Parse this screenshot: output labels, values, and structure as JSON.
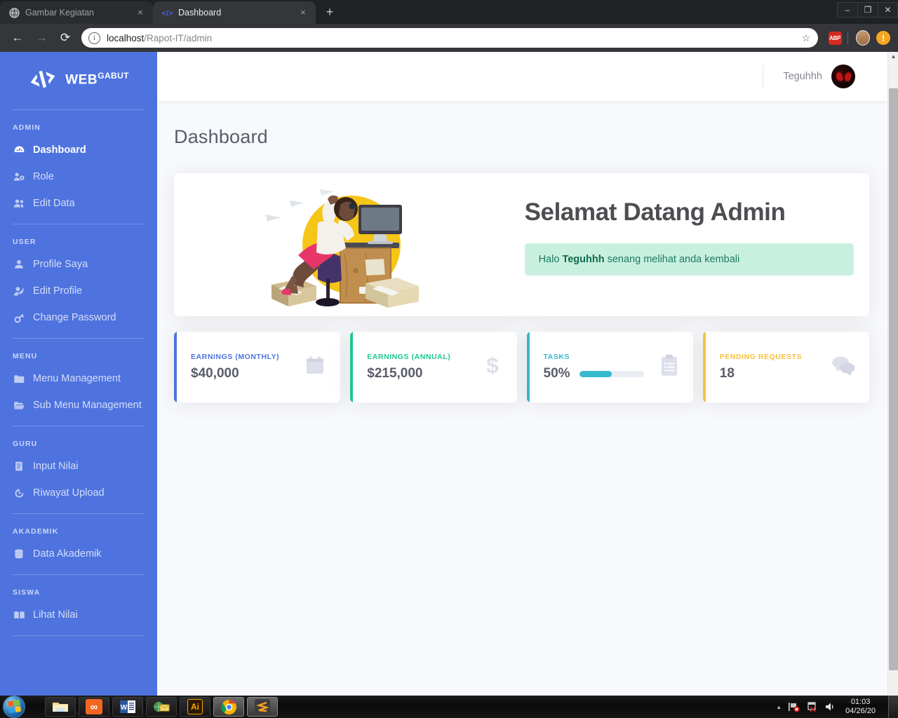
{
  "browser": {
    "tabs": [
      {
        "title": "Gambar Kegiatan",
        "favicon": "globe-icon",
        "active": false
      },
      {
        "title": "Dashboard",
        "favicon": "code-brackets-icon",
        "active": true
      }
    ],
    "new_tab_label": "+",
    "close_label": "×",
    "nav": {
      "back": "←",
      "forward": "→",
      "reload": "⟳"
    },
    "omnibox": {
      "info_icon": "i",
      "url_host": "localhost",
      "url_path": "/Rapot-IT/admin",
      "star_icon": "☆"
    },
    "extensions": [
      {
        "name": "adblock-plus-icon",
        "label": "ABP"
      },
      {
        "name": "chrome-profile-avatar",
        "label": ""
      },
      {
        "name": "update-warning-icon",
        "label": "!"
      }
    ],
    "window_controls": {
      "minimize": "–",
      "maximize": "❐",
      "close": "✕"
    }
  },
  "sidebar": {
    "brand": {
      "name": "WEB",
      "sup": "GABUT",
      "logo_icon": "code-brackets-logo"
    },
    "sections": [
      {
        "heading": "ADMIN",
        "items": [
          {
            "label": "Dashboard",
            "icon": "tachometer-icon",
            "active": true
          },
          {
            "label": "Role",
            "icon": "users-cog-icon",
            "active": false
          },
          {
            "label": "Edit Data",
            "icon": "user-friends-icon",
            "active": false
          }
        ]
      },
      {
        "heading": "USER",
        "items": [
          {
            "label": "Profile Saya",
            "icon": "user-icon",
            "active": false
          },
          {
            "label": "Edit Profile",
            "icon": "user-edit-icon",
            "active": false
          },
          {
            "label": "Change Password",
            "icon": "key-icon",
            "active": false
          }
        ]
      },
      {
        "heading": "MENU",
        "items": [
          {
            "label": "Menu Management",
            "icon": "folder-icon",
            "active": false
          },
          {
            "label": "Sub Menu Management",
            "icon": "folder-open-icon",
            "active": false
          }
        ]
      },
      {
        "heading": "GURU",
        "items": [
          {
            "label": "Input Nilai",
            "icon": "file-alt-icon",
            "active": false
          },
          {
            "label": "Riwayat Upload",
            "icon": "history-icon",
            "active": false
          }
        ]
      },
      {
        "heading": "AKADEMIK",
        "items": [
          {
            "label": "Data Akademik",
            "icon": "database-icon",
            "active": false
          }
        ]
      },
      {
        "heading": "SISWA",
        "items": [
          {
            "label": "Lihat Nilai",
            "icon": "book-open-icon",
            "active": false
          }
        ]
      }
    ]
  },
  "topbar": {
    "user_name": "Teguhhh",
    "avatar_icon": "user-avatar"
  },
  "page": {
    "title": "Dashboard"
  },
  "welcome": {
    "illustration": "person-at-desk-illustration",
    "title": "Selamat Datang Admin",
    "alert_prefix": "Halo ",
    "alert_name": "Teguhhh",
    "alert_suffix": " senang melihat anda kembali"
  },
  "stats": [
    {
      "label": "EARNINGS (MONTHLY)",
      "value": "$40,000",
      "accent": "#4e73df",
      "icon": "calendar-icon",
      "progress": null
    },
    {
      "label": "EARNINGS (ANNUAL)",
      "value": "$215,000",
      "accent": "#1cc88a",
      "icon": "dollar-sign-icon",
      "progress": null
    },
    {
      "label": "TASKS",
      "value": "50%",
      "accent": "#36b9cc",
      "icon": "clipboard-list-icon",
      "progress": 50
    },
    {
      "label": "PENDING REQUESTS",
      "value": "18",
      "accent": "#f6c23e",
      "icon": "comments-icon",
      "progress": null
    }
  ],
  "taskbar": {
    "start_label": "start-orb",
    "apps": [
      {
        "name": "windows-explorer-icon",
        "running": false
      },
      {
        "name": "xampp-icon",
        "running": false
      },
      {
        "name": "microsoft-word-icon",
        "running": false
      },
      {
        "name": "mail-network-icon",
        "running": false
      },
      {
        "name": "adobe-illustrator-icon",
        "running": false
      },
      {
        "name": "google-chrome-icon",
        "running": true
      },
      {
        "name": "sublime-text-icon",
        "running": true
      }
    ],
    "tray": {
      "arrow": "▲",
      "network_icon": "network-error-icon",
      "action_center_icon": "flag-error-icon",
      "volume_icon": "volume-icon",
      "time": "01:03",
      "date": "04/26/20"
    }
  }
}
